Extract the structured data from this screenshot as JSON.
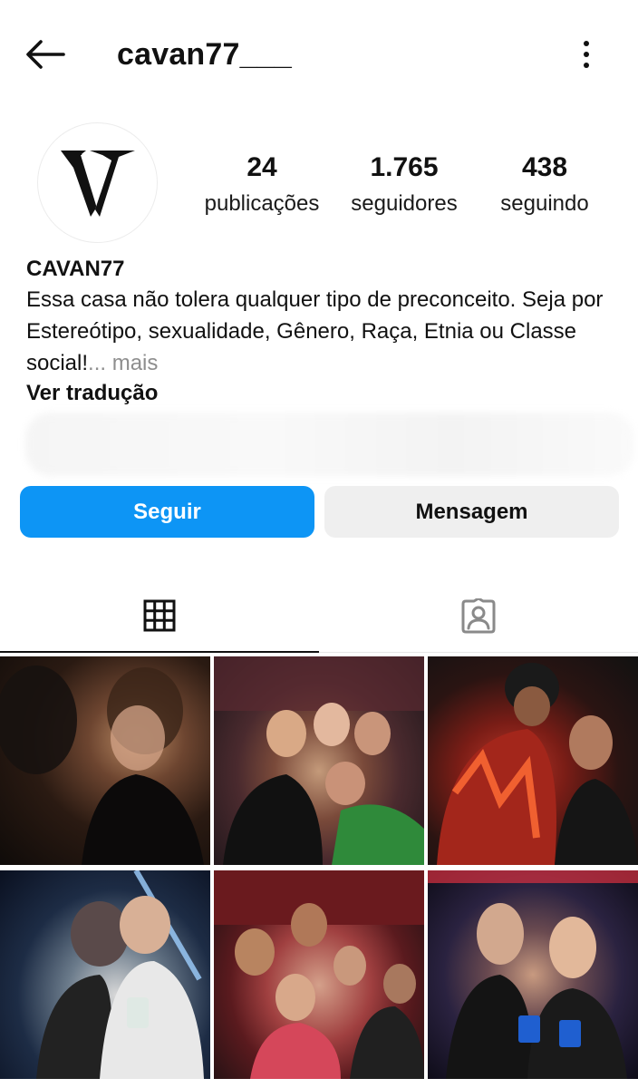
{
  "header": {
    "username": "cavan77___",
    "back_icon": "arrow-left-icon",
    "more_icon": "kebab-menu-icon"
  },
  "profile": {
    "avatar_icon": "w-logo",
    "stats": [
      {
        "value": "24",
        "label": "publicações"
      },
      {
        "value": "1.765",
        "label": "seguidores"
      },
      {
        "value": "438",
        "label": "seguindo"
      }
    ],
    "display_name": "CAVAN77",
    "bio": "Essa casa não tolera qualquer tipo de preconceito. Seja por Estereótipo, sexualidade, Gênero, Raça, Etnia ou Classe social!",
    "bio_ellipsis": "...",
    "bio_more": " mais",
    "translate_label": "Ver tradução"
  },
  "actions": {
    "follow_label": "Seguir",
    "message_label": "Mensagem"
  },
  "tabs": {
    "grid_icon": "grid-icon",
    "tagged_icon": "tagged-person-icon",
    "active": "grid"
  },
  "colors": {
    "follow_button": "#0d95f5",
    "message_button": "#efefef",
    "muted_text": "#8e8e8e"
  },
  "posts_visible": 6
}
